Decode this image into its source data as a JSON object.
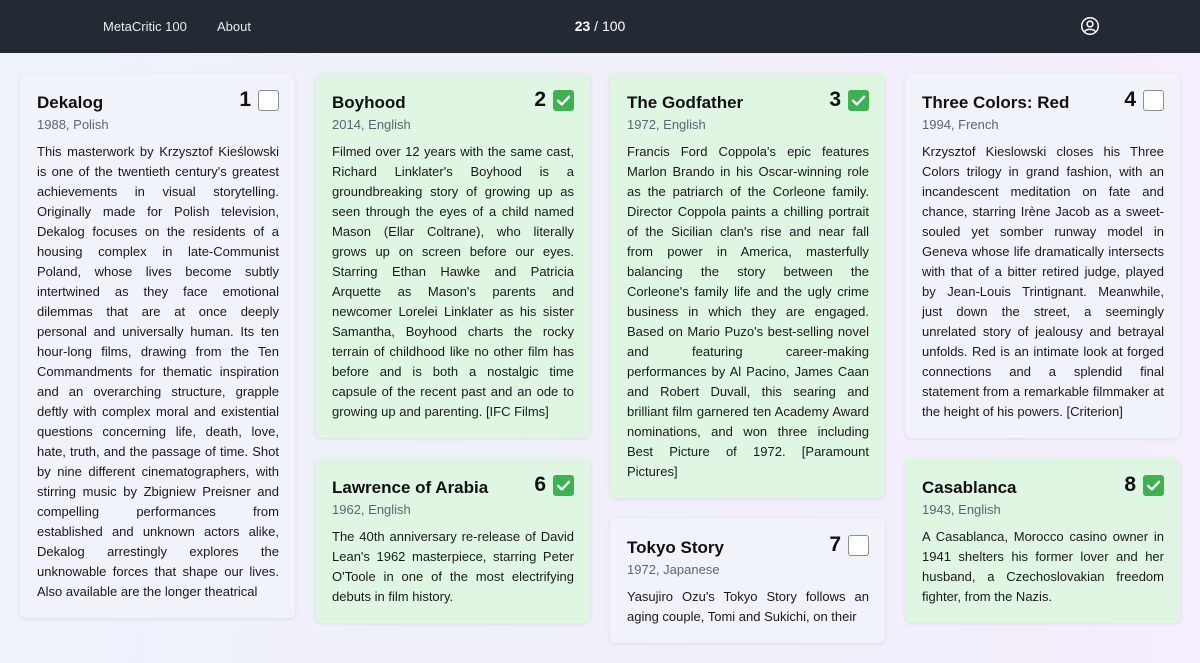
{
  "nav": {
    "home_label": "MetaCritic 100",
    "about_label": "About",
    "progress_current": "23",
    "progress_sep": " / ",
    "progress_total": "100",
    "user_icon": "user-circle-icon"
  },
  "colors": {
    "topbar": "#242a33",
    "watched_card": "#dff6e3",
    "unwatched_card": "#f0f3fa",
    "check_green": "#3db34f"
  },
  "films": [
    {
      "rank": "1",
      "title": "Dekalog",
      "meta": "1988, Polish",
      "watched": false,
      "description": "This masterwork by Krzysztof Kieślowski is one of the twentieth century's greatest achievements in visual storytelling. Originally made for Polish television, Dekalog focuses on the residents of a housing complex in late-Communist Poland, whose lives become subtly intertwined as they face emotional dilemmas that are at once deeply personal and universally human. Its ten hour-long films, drawing from the Ten Commandments for thematic inspiration and an overarching structure, grapple deftly with complex moral and existential questions concerning life, death, love, hate, truth, and the passage of time. Shot by nine different cinematographers, with stirring music by Zbigniew Preisner and compelling performances from established and unknown actors alike, Dekalog arrestingly explores the unknowable forces that shape our lives. Also available are the longer theatrical"
    },
    {
      "rank": "2",
      "title": "Boyhood",
      "meta": "2014, English",
      "watched": true,
      "description": "Filmed over 12 years with the same cast, Richard Linklater's Boyhood is a groundbreaking story of growing up as seen through the eyes of a child named Mason (Ellar Coltrane), who literally grows up on screen before our eyes. Starring Ethan Hawke and Patricia Arquette as Mason's parents and newcomer Lorelei Linklater as his sister Samantha, Boyhood charts the rocky terrain of childhood like no other film has before and is both a nostalgic time capsule of the recent past and an ode to growing up and parenting. [IFC Films]"
    },
    {
      "rank": "3",
      "title": "The Godfather",
      "meta": "1972, English",
      "watched": true,
      "description": "Francis Ford Coppola's epic features Marlon Brando in his Oscar-winning role as the patriarch of the Corleone family. Director Coppola paints a chilling portrait of the Sicilian clan's rise and near fall from power in America, masterfully balancing the story between the Corleone's family life and the ugly crime business in which they are engaged. Based on Mario Puzo's best-selling novel and featuring career-making performances by Al Pacino, James Caan and Robert Duvall, this searing and brilliant film garnered ten Academy Award nominations, and won three including Best Picture of 1972. [Paramount Pictures]"
    },
    {
      "rank": "4",
      "title": "Three Colors: Red",
      "meta": "1994, French",
      "watched": false,
      "description": "Krzysztof Kieslowski closes his Three Colors trilogy in grand fashion, with an incandescent meditation on fate and chance, starring Irène Jacob as a sweet-souled yet somber runway model in Geneva whose life dramatically intersects with that of a bitter retired judge, played by Jean-Louis Trintignant. Meanwhile, just down the street, a seemingly unrelated story of jealousy and betrayal unfolds. Red is an intimate look at forged connections and a splendid final statement from a remarkable filmmaker at the height of his powers. [Criterion]"
    },
    {
      "rank": "6",
      "title": "Lawrence of Arabia",
      "meta": "1962, English",
      "watched": true,
      "description": "The 40th anniversary re-release of David Lean's 1962 masterpiece, starring Peter O'Toole in one of the most electrifying debuts in film history."
    },
    {
      "rank": "7",
      "title": "Tokyo Story",
      "meta": "1972, Japanese",
      "watched": false,
      "description": "Yasujiro Ozu's Tokyo Story follows an aging couple, Tomi and Sukichi, on their"
    },
    {
      "rank": "8",
      "title": "Casablanca",
      "meta": "1943, English",
      "watched": true,
      "description": "A Casablanca, Morocco casino owner in 1941 shelters his former lover and her husband, a Czechoslovakian freedom fighter, from the Nazis."
    }
  ]
}
